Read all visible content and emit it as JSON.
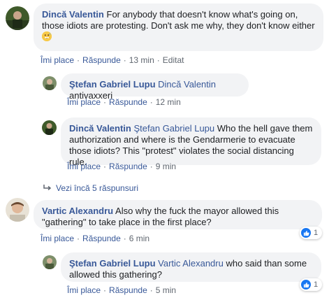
{
  "comments": [
    {
      "author": "Dincă Valentin",
      "text": "For anybody that doesn't know what's going on, those idiots are protesting. Don't ask me why, they don't know either",
      "emoji": "grinning-sweat-emoji",
      "actions": {
        "like": "Îmi place",
        "reply": "Răspunde",
        "time": "13 min",
        "edited": "Editat"
      }
    },
    {
      "author": "Ştefan Gabriel Lupu",
      "mention": "Dincă Valentin",
      "text": "antivaxxeri",
      "actions": {
        "like": "Îmi place",
        "reply": "Răspunde",
        "time": "12 min"
      }
    },
    {
      "author": "Dincă Valentin",
      "mention": "Ştefan Gabriel Lupu",
      "text": "Who the hell gave them authorization and where is the Gendarmerie to evacuate those idiots? This \"protest\" violates the social distancing rule.",
      "actions": {
        "like": "Îmi place",
        "reply": "Răspunde",
        "time": "9 min"
      }
    },
    {
      "author": "Vartic Alexandru",
      "text": "Also why the fuck the mayor allowed this \"gathering\" to take place in the first place?",
      "reaction_count": "1",
      "actions": {
        "like": "Îmi place",
        "reply": "Răspunde",
        "time": "6 min"
      }
    },
    {
      "author": "Ştefan Gabriel Lupu",
      "mention": "Vartic Alexandru",
      "text": "who said than some allowed this gathering?",
      "reaction_count": "1",
      "actions": {
        "like": "Îmi place",
        "reply": "Răspunde",
        "time": "5 min"
      }
    }
  ],
  "more_replies": "Vezi încă 5 răspunsuri",
  "separator": "·",
  "icons": {
    "like": "like-icon",
    "reply_arrow": "reply-arrow-icon"
  },
  "colors": {
    "link": "#385898",
    "bubble": "#f2f3f5",
    "meta": "#606770",
    "like_blue": "#1877f2"
  }
}
